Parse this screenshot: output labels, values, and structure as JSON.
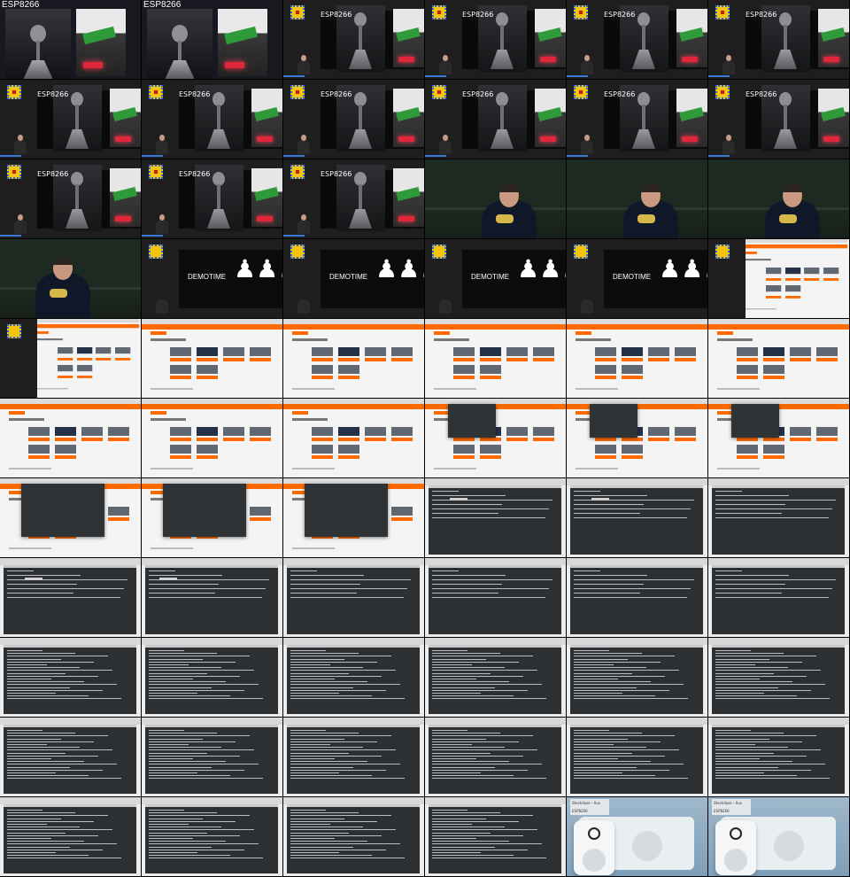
{
  "slide_title": "ESP8266",
  "demo_text": "DEMOTIME",
  "frames": [
    "cam-full",
    "cam-full",
    "slide",
    "slide",
    "slide",
    "slide",
    "slide",
    "slide",
    "slide",
    "slide",
    "slide",
    "slide",
    "slide",
    "slide",
    "slide",
    "person",
    "person",
    "person",
    "person",
    "demo",
    "demo",
    "demo",
    "demo",
    "web-window",
    "web-window",
    "web",
    "web",
    "web",
    "web",
    "web",
    "web",
    "web",
    "web",
    "web-term",
    "web-term",
    "web-term",
    "term-over-web",
    "term-over-web",
    "term-over-web",
    "term",
    "term",
    "term",
    "term",
    "term",
    "term",
    "term",
    "term",
    "term",
    "term",
    "term",
    "term",
    "term",
    "term",
    "term",
    "term",
    "term",
    "term",
    "term",
    "term",
    "term",
    "term",
    "term",
    "term",
    "term",
    "socket",
    "socket"
  ],
  "socket_overlay": {
    "line1": "Steckdose - Aus",
    "line2": "ESP8266"
  }
}
